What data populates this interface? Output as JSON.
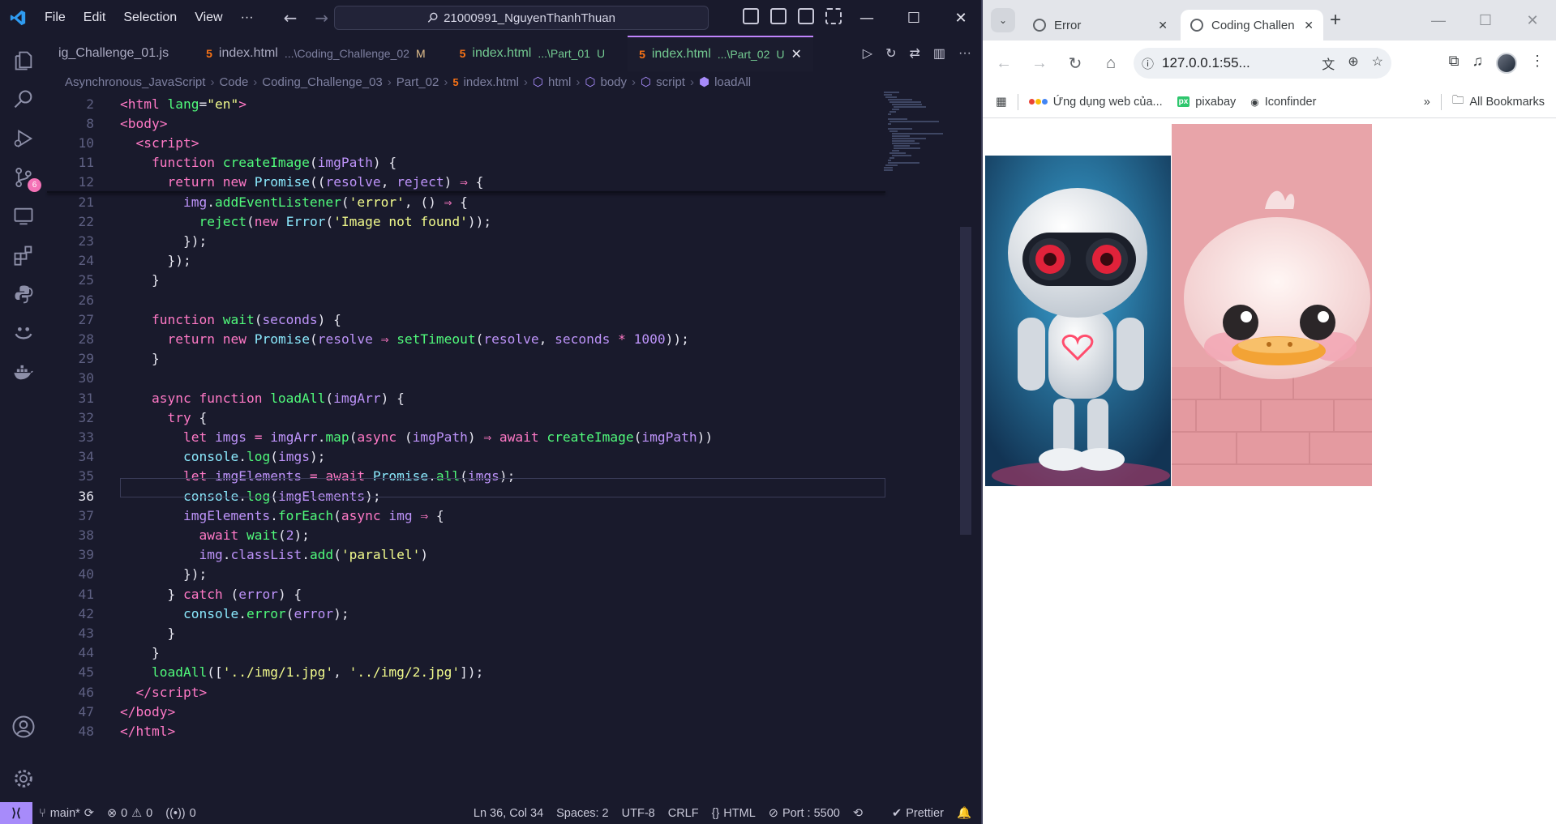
{
  "vscode": {
    "menu": [
      "File",
      "Edit",
      "Selection",
      "View",
      "···"
    ],
    "search_text": "21000991_NguyenThanhThuan",
    "tabs": [
      {
        "name": "ig_Challenge_01.js",
        "path": "",
        "status": ""
      },
      {
        "name": "index.html",
        "path": "...\\Coding_Challenge_02",
        "status": "M"
      },
      {
        "name": "index.html",
        "path": "...\\Part_01",
        "status": "U"
      },
      {
        "name": "index.html",
        "path": "...\\Part_02",
        "status": "U"
      }
    ],
    "activity_badge": "6",
    "breadcrumb": [
      "Asynchronous_JavaScript",
      "Code",
      "Coding_Challenge_03",
      "Part_02",
      "index.html",
      "html",
      "body",
      "script",
      "loadAll"
    ],
    "code_lines": [
      {
        "n": "2",
        "html": "<span class='tg'>&lt;html</span> <span class='at'>lang</span>=<span class='st'>\"en\"</span><span class='tg'>&gt;</span>"
      },
      {
        "n": "8",
        "html": "<span class='tg'>&lt;body&gt;</span>"
      },
      {
        "n": "10",
        "html": "  <span class='tg'>&lt;script&gt;</span>"
      },
      {
        "n": "11",
        "html": "    <span class='kw'>function</span> <span class='fn'>createImage</span>(<span class='pr'>imgPath</span>) {"
      },
      {
        "n": "12",
        "html": "      <span class='kw'>return</span> <span class='kw'>new</span> <span class='cl'>Promise</span>((<span class='pr'>resolve</span>, <span class='pr'>reject</span>) <span class='op'>⇒</span> {"
      },
      {
        "n": "21",
        "html": "        <span class='pr'>img</span>.<span class='fn'>addEventListener</span>(<span class='st'>'error'</span>, () <span class='op'>⇒</span> {"
      },
      {
        "n": "22",
        "html": "          <span class='fn'>reject</span>(<span class='kw'>new</span> <span class='cl'>Error</span>(<span class='st'>'Image not found'</span>));"
      },
      {
        "n": "23",
        "html": "        });"
      },
      {
        "n": "24",
        "html": "      });"
      },
      {
        "n": "25",
        "html": "    }"
      },
      {
        "n": "26",
        "html": ""
      },
      {
        "n": "27",
        "html": "    <span class='kw'>function</span> <span class='fn'>wait</span>(<span class='pr'>seconds</span>) {"
      },
      {
        "n": "28",
        "html": "      <span class='kw'>return</span> <span class='kw'>new</span> <span class='cl'>Promise</span>(<span class='pr'>resolve</span> <span class='op'>⇒</span> <span class='fn'>setTimeout</span>(<span class='pr'>resolve</span>, <span class='pr'>seconds</span> <span class='op'>*</span> <span class='pr'>1000</span>));"
      },
      {
        "n": "29",
        "html": "    }"
      },
      {
        "n": "30",
        "html": ""
      },
      {
        "n": "31",
        "html": "    <span class='kw'>async</span> <span class='kw'>function</span> <span class='fn'>loadAll</span>(<span class='pr'>imgArr</span>) {"
      },
      {
        "n": "32",
        "html": "      <span class='kw'>try</span> {"
      },
      {
        "n": "33",
        "html": "        <span class='kw'>let</span> <span class='pr'>imgs</span> <span class='op'>=</span> <span class='pr'>imgArr</span>.<span class='fn'>map</span>(<span class='kw'>async</span> (<span class='pr'>imgPath</span>) <span class='op'>⇒</span> <span class='kw'>await</span> <span class='fn'>createImage</span>(<span class='pr'>imgPath</span>))"
      },
      {
        "n": "34",
        "html": "        <span class='cl'>console</span>.<span class='fn'>log</span>(<span class='pr'>imgs</span>);"
      },
      {
        "n": "35",
        "html": "        <span class='kw'>let</span> <span class='pr'>imgElements</span> <span class='op'>=</span> <span class='kw'>await</span> <span class='cl'>Promise</span>.<span class='fn'>all</span>(<span class='pr'>imgs</span>);"
      },
      {
        "n": "36",
        "html": "        <span class='cl'>console</span>.<span class='fn'>log</span>(<span class='pr'>imgElements</span>);"
      },
      {
        "n": "37",
        "html": "        <span class='pr'>imgElements</span>.<span class='fn'>forEach</span>(<span class='kw'>async</span> <span class='pr'>img</span> <span class='op'>⇒</span> {"
      },
      {
        "n": "38",
        "html": "          <span class='kw'>await</span> <span class='fn'>wait</span>(<span class='pr'>2</span>);"
      },
      {
        "n": "39",
        "html": "          <span class='pr'>img</span>.<span class='pr'>classList</span>.<span class='fn'>add</span>(<span class='st'>'parallel'</span>)"
      },
      {
        "n": "40",
        "html": "        });"
      },
      {
        "n": "41",
        "html": "      } <span class='kw'>catch</span> (<span class='pr'>error</span>) {"
      },
      {
        "n": "42",
        "html": "        <span class='cl'>console</span>.<span class='fn'>error</span>(<span class='pr'>error</span>);"
      },
      {
        "n": "43",
        "html": "      }"
      },
      {
        "n": "44",
        "html": "    }"
      },
      {
        "n": "45",
        "html": "    <span class='fn'>loadAll</span>([<span class='st'>'../img/1.jpg'</span>, <span class='st'>'../img/2.jpg'</span>]);"
      },
      {
        "n": "46",
        "html": "  <span class='tg'>&lt;/script&gt;</span>"
      },
      {
        "n": "47",
        "html": "<span class='tg'>&lt;/body&gt;</span>"
      },
      {
        "n": "48",
        "html": "<span class='tg'>&lt;/html&gt;</span>"
      }
    ],
    "current_line": "36",
    "status": {
      "branch": "main*",
      "errors": "0",
      "warnings": "0",
      "ports": "0",
      "position": "Ln 36, Col 34",
      "spaces": "Spaces: 2",
      "encoding": "UTF-8",
      "eol": "CRLF",
      "language": "HTML",
      "port": "Port : 5500",
      "prettier": "Prettier"
    },
    "accent": "#a78bfa"
  },
  "chrome": {
    "tabs": [
      {
        "title": "Error",
        "active": false
      },
      {
        "title": "Coding Challen",
        "active": true
      }
    ],
    "url": "127.0.0.1:55...",
    "bookmarks": [
      "Ứng dụng web của...",
      "pixabay",
      "Iconfinder",
      "All Bookmarks"
    ],
    "page_images": [
      "robot-image",
      "duck-image"
    ]
  }
}
